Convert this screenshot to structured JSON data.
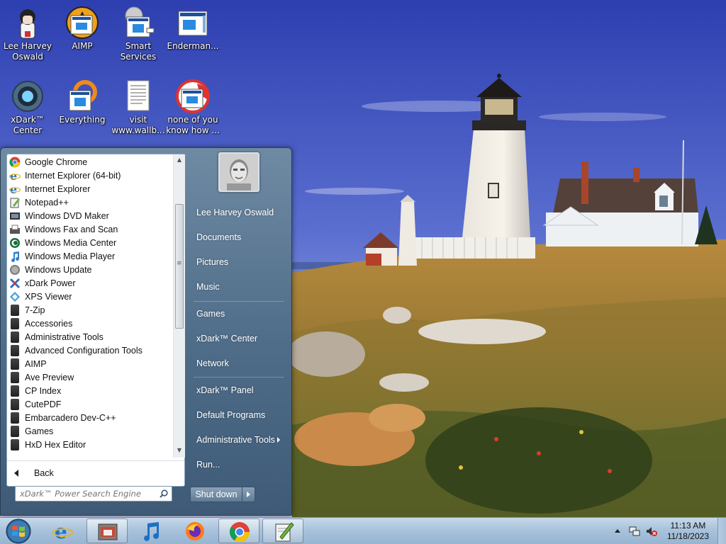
{
  "desktop": {
    "icons": [
      {
        "label": "Lee Harvey\nOswald",
        "icon": "user-folder-icon"
      },
      {
        "label": "AIMP",
        "icon": "aimp-icon"
      },
      {
        "label": "Smart\nServices",
        "icon": "smart-services-icon"
      },
      {
        "label": "Enderman...",
        "icon": "app-window-icon"
      },
      {
        "label": "xDark™\nCenter",
        "icon": "xdark-center-icon"
      },
      {
        "label": "Everything",
        "icon": "everything-icon"
      },
      {
        "label": "visit\nwww.wallb...",
        "icon": "text-document-icon"
      },
      {
        "label": "none of you\nknow how ...",
        "icon": "app-window-icon"
      }
    ]
  },
  "start_menu": {
    "programs": [
      {
        "label": "Google Chrome",
        "icon": "chrome-icon"
      },
      {
        "label": "Internet Explorer (64-bit)",
        "icon": "internet-explorer-icon"
      },
      {
        "label": "Internet Explorer",
        "icon": "internet-explorer-icon"
      },
      {
        "label": "Notepad++",
        "icon": "notepad-plus-plus-icon"
      },
      {
        "label": "Windows DVD Maker",
        "icon": "dvd-maker-icon"
      },
      {
        "label": "Windows Fax and Scan",
        "icon": "fax-scan-icon"
      },
      {
        "label": "Windows Media Center",
        "icon": "media-center-icon"
      },
      {
        "label": "Windows Media Player",
        "icon": "media-player-icon"
      },
      {
        "label": "Windows Update",
        "icon": "windows-update-icon"
      },
      {
        "label": "xDark Power",
        "icon": "xdark-power-icon"
      },
      {
        "label": "XPS Viewer",
        "icon": "xps-viewer-icon"
      },
      {
        "label": "7-Zip",
        "icon": "folder-icon"
      },
      {
        "label": "Accessories",
        "icon": "folder-icon"
      },
      {
        "label": "Administrative Tools",
        "icon": "folder-icon"
      },
      {
        "label": "Advanced Configuration Tools",
        "icon": "folder-icon"
      },
      {
        "label": "AIMP",
        "icon": "folder-icon"
      },
      {
        "label": "Ave Preview",
        "icon": "folder-icon"
      },
      {
        "label": "CP Index",
        "icon": "folder-icon"
      },
      {
        "label": "CutePDF",
        "icon": "folder-icon"
      },
      {
        "label": "Embarcadero Dev-C++",
        "icon": "folder-icon"
      },
      {
        "label": "Games",
        "icon": "folder-icon"
      },
      {
        "label": "HxD Hex Editor",
        "icon": "folder-icon"
      }
    ],
    "back_label": "Back",
    "search_placeholder": "xDark™ Power Search Engine",
    "right_items": {
      "user": "Lee Harvey Oswald",
      "documents": "Documents",
      "pictures": "Pictures",
      "music": "Music",
      "games": "Games",
      "xdark_center": "xDark™ Center",
      "network": "Network",
      "xdark_panel": "xDark™ Panel",
      "default_programs": "Default Programs",
      "admin_tools": "Administrative Tools",
      "run": "Run..."
    },
    "shutdown_label": "Shut down"
  },
  "taskbar": {
    "buttons": [
      {
        "name": "internet-explorer",
        "icon": "internet-explorer-icon",
        "active": false
      },
      {
        "name": "media-tool",
        "icon": "media-tool-icon",
        "active": true
      },
      {
        "name": "music-player",
        "icon": "music-note-icon",
        "active": false
      },
      {
        "name": "firefox",
        "icon": "firefox-icon",
        "active": false
      },
      {
        "name": "chrome",
        "icon": "chrome-icon",
        "active": true
      },
      {
        "name": "notepad-plus-plus",
        "icon": "notepad-plus-plus-icon",
        "active": true
      }
    ],
    "clock_time": "11:13 AM",
    "clock_date": "11/18/2023"
  }
}
